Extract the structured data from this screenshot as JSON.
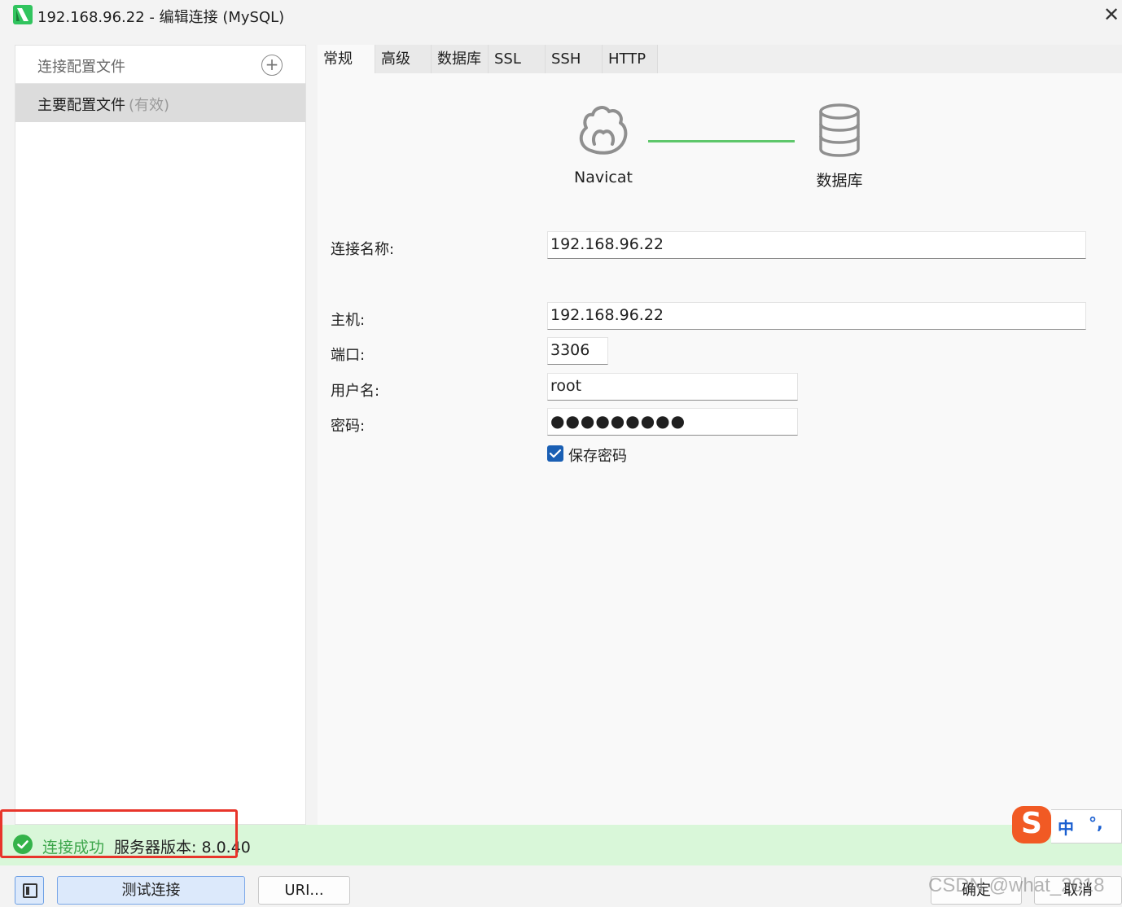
{
  "window": {
    "title": "192.168.96.22 - 编辑连接 (MySQL)",
    "close_glyph": "✕"
  },
  "sidebar": {
    "header_label": "连接配置文件",
    "add_glyph": "+",
    "profiles": [
      {
        "name": "主要配置文件",
        "status": "(有效)"
      }
    ]
  },
  "tabs": [
    {
      "label": "常规",
      "active": true
    },
    {
      "label": "高级"
    },
    {
      "label": "数据库"
    },
    {
      "label": "SSL"
    },
    {
      "label": "SSH"
    },
    {
      "label": "HTTP"
    }
  ],
  "diagram": {
    "left_label": "Navicat",
    "right_label": "数据库",
    "line_color": "#5ec76b"
  },
  "form": {
    "connection_name_label": "连接名称:",
    "connection_name_value": "192.168.96.22",
    "host_label": "主机:",
    "host_value": "192.168.96.22",
    "port_label": "端口:",
    "port_value": "3306",
    "username_label": "用户名:",
    "username_value": "root",
    "password_label": "密码:",
    "password_value": "●●●●●●●●●",
    "save_password_label": "保存密码",
    "save_password_checked": true
  },
  "status": {
    "ok_text": "连接成功",
    "server_version_label": "服务器版本: 8.0.40",
    "ok_color": "#3ea64c",
    "highlight_color": "#e8352b"
  },
  "ime": {
    "logo": "S",
    "lang": "中",
    "punct": "°,"
  },
  "buttons": {
    "test_connection": "测试连接",
    "uri": "URI...",
    "ok": "确定",
    "cancel": "取消"
  },
  "watermark": "CSDN @what_2018"
}
